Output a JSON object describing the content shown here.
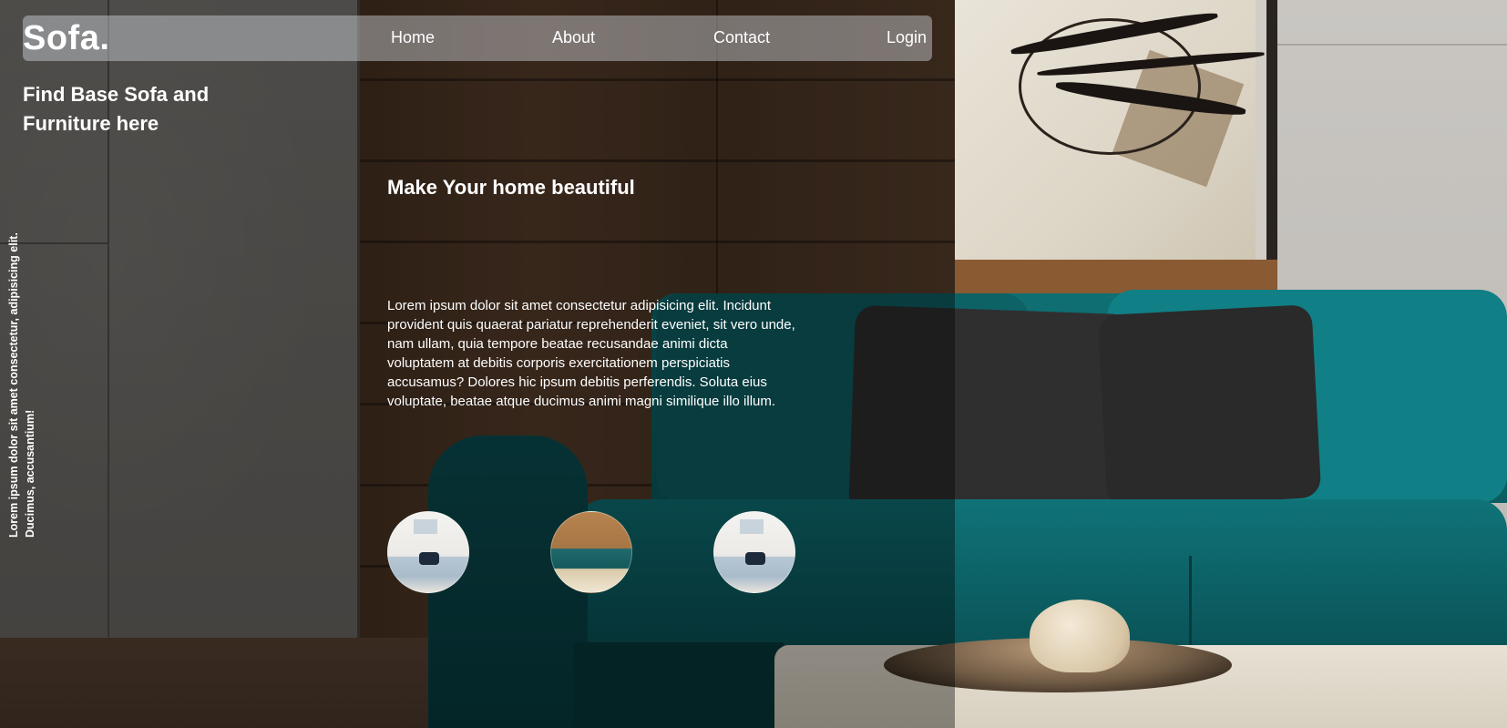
{
  "nav": {
    "logo": "Sofa.",
    "items": [
      {
        "label": "Home"
      },
      {
        "label": "About"
      },
      {
        "label": "Contact"
      },
      {
        "label": "Login"
      }
    ]
  },
  "tagline": "Find Base Sofa and Furniture here",
  "vertical_text": "Lorem ipsum dolor sit amet consectetur, adipisicing elit. Ducimus, accusantium!",
  "hero": {
    "headline": "Make Your home beautiful",
    "paragraph": "Lorem ipsum dolor sit amet consectetur adipisicing elit. Incidunt provident quis quaerat pariatur reprehenderit eveniet, sit vero unde, nam ullam, quia tempore beatae recusandae animi dicta voluptatem at debitis corporis exercitationem perspiciatis accusamus? Dolores hic ipsum debitis perferendis. Soluta eius voluptate, beatae atque ducimus animi magni similique illo illum."
  },
  "thumbnails": [
    {
      "name": "living-room-light"
    },
    {
      "name": "living-room-teal"
    },
    {
      "name": "living-room-light"
    }
  ],
  "colors": {
    "accent_sofa": "#0f6f73",
    "nav_bg": "rgba(210,214,222,0.45)",
    "text": "#ffffff"
  }
}
